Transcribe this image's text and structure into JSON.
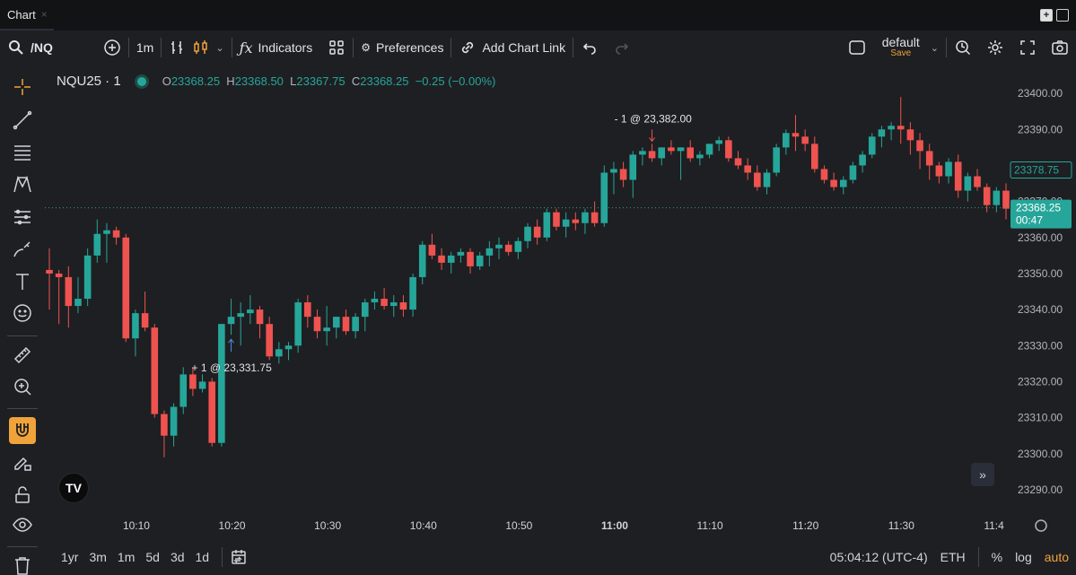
{
  "tab": {
    "title": "Chart",
    "close": "×"
  },
  "toolbar": {
    "symbol": "/NQ",
    "interval": "1m",
    "indicators": "Indicators",
    "preferences": "Preferences",
    "add_chart_link": "Add Chart Link",
    "layout_name": "default",
    "layout_save": "Save"
  },
  "legend": {
    "symbol": "NQU25 · 1",
    "open_label": "O",
    "open": "23368.25",
    "high_label": "H",
    "high": "23368.50",
    "low_label": "L",
    "low": "23367.75",
    "close_label": "C",
    "close": "23368.25",
    "change": "−0.25 (−0.00%)"
  },
  "colors": {
    "up": "#26a69a",
    "down": "#ef5350",
    "accent": "#f0a33a",
    "background": "#1e1f22"
  },
  "chart_data": {
    "type": "candlestick",
    "ylim": [
      23286,
      23406
    ],
    "y_ticks": [
      "23400.00",
      "23390.00",
      "23380.00",
      "23370.00",
      "23360.00",
      "23350.00",
      "23340.00",
      "23330.00",
      "23320.00",
      "23310.00",
      "23300.00",
      "23290.00"
    ],
    "y_tick_values": [
      23400,
      23390,
      23380,
      23370,
      23360,
      23350,
      23340,
      23330,
      23320,
      23310,
      23300,
      23290
    ],
    "x_ticks": [
      "10:10",
      "10:20",
      "10:30",
      "10:40",
      "10:50",
      "11:00",
      "11:10",
      "11:20",
      "11:30",
      "11:4"
    ],
    "x_tick_index": [
      9,
      19,
      29,
      39,
      49,
      59,
      69,
      79,
      89,
      99
    ],
    "candles": [
      [
        23351,
        23357,
        23340,
        23350
      ],
      [
        23350,
        23351,
        23336,
        23349
      ],
      [
        23349,
        23352,
        23335,
        23341
      ],
      [
        23341,
        23349,
        23339,
        23343
      ],
      [
        23343,
        23357,
        23341,
        23355
      ],
      [
        23355,
        23365,
        23353,
        23361
      ],
      [
        23361,
        23364,
        23353,
        23362
      ],
      [
        23362,
        23363,
        23358,
        23360
      ],
      [
        23360,
        23361,
        23331,
        23332
      ],
      [
        23332,
        23340,
        23327,
        23339
      ],
      [
        23339,
        23345,
        23334,
        23335
      ],
      [
        23335,
        23336,
        23310,
        23311
      ],
      [
        23311,
        23312,
        23299,
        23305
      ],
      [
        23305,
        23314,
        23302,
        23313
      ],
      [
        23313,
        23324,
        23311,
        23322
      ],
      [
        23322,
        23324,
        23316,
        23318
      ],
      [
        23318,
        23322,
        23317,
        23320
      ],
      [
        23320,
        23321,
        23302,
        23303
      ],
      [
        23303,
        23336,
        23302,
        23336
      ],
      [
        23336,
        23343,
        23333,
        23338
      ],
      [
        23338,
        23342,
        23330,
        23339
      ],
      [
        23339,
        23344,
        23336,
        23340
      ],
      [
        23340,
        23341,
        23332,
        23336
      ],
      [
        23336,
        23338,
        23326,
        23327
      ],
      [
        23327,
        23331,
        23325,
        23329
      ],
      [
        23329,
        23331,
        23326,
        23330
      ],
      [
        23330,
        23343,
        23328,
        23342
      ],
      [
        23342,
        23344,
        23335,
        23338
      ],
      [
        23338,
        23340,
        23332,
        23334
      ],
      [
        23334,
        23341,
        23330,
        23335
      ],
      [
        23335,
        23338,
        23332,
        23338
      ],
      [
        23338,
        23340,
        23333,
        23334
      ],
      [
        23334,
        23339,
        23332,
        23338
      ],
      [
        23338,
        23343,
        23334,
        23342
      ],
      [
        23342,
        23345,
        23340,
        23343
      ],
      [
        23343,
        23346,
        23340,
        23341
      ],
      [
        23341,
        23344,
        23338,
        23342
      ],
      [
        23342,
        23344,
        23338,
        23340
      ],
      [
        23340,
        23350,
        23338,
        23349
      ],
      [
        23349,
        23359,
        23347,
        23358
      ],
      [
        23358,
        23361,
        23354,
        23355
      ],
      [
        23355,
        23357,
        23351,
        23353
      ],
      [
        23353,
        23356,
        23350,
        23355
      ],
      [
        23355,
        23357,
        23353,
        23356
      ],
      [
        23356,
        23357,
        23350,
        23352
      ],
      [
        23352,
        23356,
        23351,
        23355
      ],
      [
        23355,
        23359,
        23352,
        23357
      ],
      [
        23357,
        23360,
        23354,
        23358
      ],
      [
        23358,
        23359,
        23355,
        23356
      ],
      [
        23356,
        23360,
        23354,
        23359
      ],
      [
        23359,
        23364,
        23357,
        23363
      ],
      [
        23363,
        23365,
        23358,
        23360
      ],
      [
        23360,
        23368,
        23359,
        23367
      ],
      [
        23367,
        23368,
        23362,
        23363
      ],
      [
        23363,
        23367,
        23360,
        23365
      ],
      [
        23365,
        23367,
        23362,
        23364
      ],
      [
        23364,
        23368,
        23361,
        23367
      ],
      [
        23367,
        23370,
        23363,
        23364
      ],
      [
        23364,
        23380,
        23363,
        23378
      ],
      [
        23378,
        23381,
        23372,
        23379
      ],
      [
        23379,
        23381,
        23374,
        23376
      ],
      [
        23376,
        23384,
        23371,
        23383
      ],
      [
        23383,
        23385,
        23380,
        23384
      ],
      [
        23384,
        23386,
        23381,
        23382
      ],
      [
        23382,
        23385,
        23380,
        23385
      ],
      [
        23385,
        23387,
        23383,
        23384
      ],
      [
        23384,
        23385,
        23376,
        23385
      ],
      [
        23385,
        23387,
        23381,
        23382
      ],
      [
        23382,
        23384,
        23380,
        23383
      ],
      [
        23383,
        23386,
        23382,
        23386
      ],
      [
        23386,
        23388,
        23384,
        23387
      ],
      [
        23387,
        23388,
        23381,
        23382
      ],
      [
        23382,
        23384,
        23379,
        23380
      ],
      [
        23380,
        23382,
        23376,
        23378
      ],
      [
        23378,
        23380,
        23373,
        23374
      ],
      [
        23374,
        23379,
        23372,
        23378
      ],
      [
        23378,
        23386,
        23377,
        23385
      ],
      [
        23385,
        23390,
        23383,
        23389
      ],
      [
        23389,
        23394,
        23384,
        23388
      ],
      [
        23388,
        23390,
        23384,
        23386
      ],
      [
        23386,
        23388,
        23378,
        23379
      ],
      [
        23379,
        23380,
        23375,
        23376
      ],
      [
        23376,
        23378,
        23373,
        23374
      ],
      [
        23374,
        23377,
        23372,
        23376
      ],
      [
        23376,
        23381,
        23375,
        23380
      ],
      [
        23380,
        23384,
        23378,
        23383
      ],
      [
        23383,
        23389,
        23382,
        23388
      ],
      [
        23388,
        23391,
        23385,
        23390
      ],
      [
        23390,
        23392,
        23387,
        23391
      ],
      [
        23391,
        23399,
        23386,
        23390
      ],
      [
        23390,
        23392,
        23383,
        23387
      ],
      [
        23387,
        23389,
        23379,
        23384
      ],
      [
        23384,
        23386,
        23376,
        23380
      ],
      [
        23380,
        23381,
        23375,
        23377
      ],
      [
        23377,
        23382,
        23375,
        23381
      ],
      [
        23381,
        23383,
        23371,
        23373
      ],
      [
        23373,
        23378,
        23370,
        23377
      ],
      [
        23377,
        23379,
        23373,
        23374
      ],
      [
        23374,
        23375,
        23367,
        23369
      ],
      [
        23369,
        23374,
        23367,
        23373
      ],
      [
        23373,
        23375,
        23365,
        23368
      ]
    ],
    "last_price": "23368.25",
    "last_price_value": 23368.25,
    "countdown": "00:47",
    "alt_price": "23378.75",
    "alt_price_value": 23378.75,
    "annotations": [
      {
        "text": "- 1 @ 23,382.00",
        "candle": 63,
        "value": 23382,
        "side": "sell"
      },
      {
        "text": "+ 1 @ 23,331.75",
        "candle": 19,
        "value": 23331.75,
        "side": "buy"
      }
    ]
  },
  "bottombar": {
    "ranges": [
      "1yr",
      "3m",
      "1m",
      "5d",
      "3d",
      "1d"
    ],
    "time": "05:04:12 (UTC-4)",
    "session": "ETH",
    "percent": "%",
    "log": "log",
    "auto": "auto"
  }
}
